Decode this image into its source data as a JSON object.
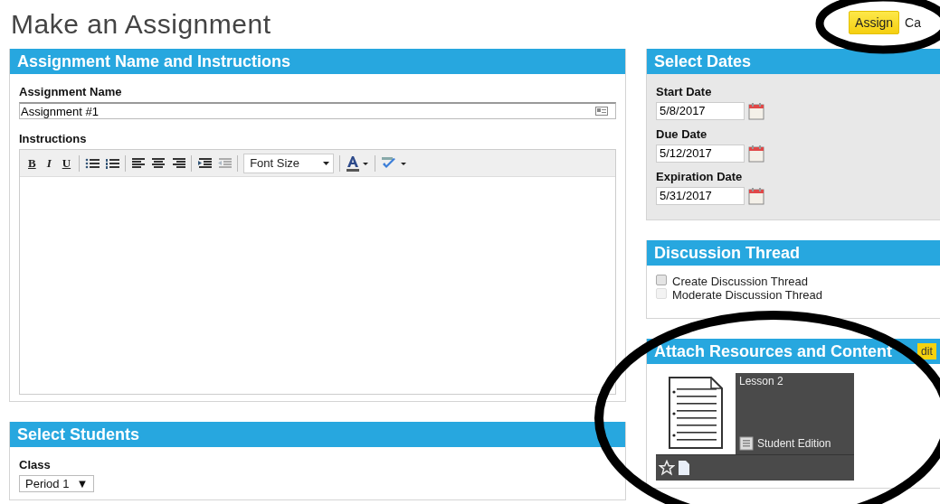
{
  "page": {
    "title": "Make an Assignment"
  },
  "actions": [
    {
      "kind": "primary",
      "label": "Assign"
    },
    {
      "kind": "link",
      "label": "Ca"
    }
  ],
  "assignment": {
    "heading": "Assignment Name and Instructions",
    "name_label": "Assignment Name",
    "name_value": "Assignment #1",
    "instructions_label": "Instructions",
    "toolbar": {
      "bold": "B",
      "italic": "I",
      "underline": "U",
      "font_size": "Font Size"
    }
  },
  "students": {
    "heading": "Select Students",
    "class_label": "Class",
    "class_value": "Period 1",
    "caret": "▼"
  },
  "dates": {
    "heading": "Select Dates",
    "fields": [
      {
        "label": "Start Date",
        "value": "5/8/2017"
      },
      {
        "label": "Due Date",
        "value": "5/12/2017"
      },
      {
        "label": "Expiration Date",
        "value": "5/31/2017"
      }
    ]
  },
  "discussion": {
    "heading": "Discussion Thread",
    "options": [
      {
        "label": "Create Discussion Thread",
        "checked": false,
        "disabled": false
      },
      {
        "label": "Moderate Discussion Thread",
        "checked": false,
        "disabled": true
      }
    ]
  },
  "resources": {
    "heading": "Attach Resources and Content",
    "edit": "dit",
    "items": [
      {
        "title": "Lesson 2",
        "edition": "Student Edition"
      }
    ]
  }
}
